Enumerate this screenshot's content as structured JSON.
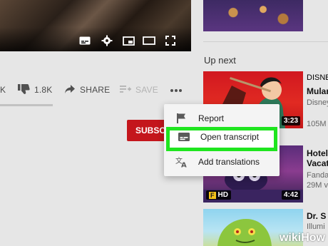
{
  "player": {
    "controls": [
      "subtitles-icon",
      "gear-icon",
      "miniplayer-icon",
      "theater-icon",
      "fullscreen-icon"
    ]
  },
  "actions": {
    "dislike_count": "1.8K",
    "share_label": "SHARE",
    "save_label": "SAVE",
    "partial_left": "K"
  },
  "subscribe": {
    "label": "SUBSCRIBE"
  },
  "menu": {
    "items": [
      {
        "label": "Report",
        "icon": "flag-icon"
      },
      {
        "label": "Open transcript",
        "icon": "transcript-icon",
        "highlighted": true
      },
      {
        "label": "Add translations",
        "icon": "translate-icon"
      }
    ]
  },
  "sidebar": {
    "up_next_label": "Up next",
    "videos": [
      {
        "title": "Mulan",
        "channel_prefix": "DISNE",
        "meta_1": "Disney",
        "meta_2": "105M",
        "duration": "3:23"
      },
      {
        "title": "Hotel",
        "title_2": "Vacat",
        "meta_1": "Fanda",
        "meta_2": "29M v",
        "duration": "4:42",
        "badge": "HD"
      },
      {
        "title": "Dr. S",
        "meta_1": "Illumi",
        "meta_2": ""
      }
    ]
  },
  "watermark": {
    "wiki": "wiki",
    "how": "How"
  },
  "colors": {
    "highlight_border": "#1fe51f",
    "subscribe": "#c4161c"
  }
}
